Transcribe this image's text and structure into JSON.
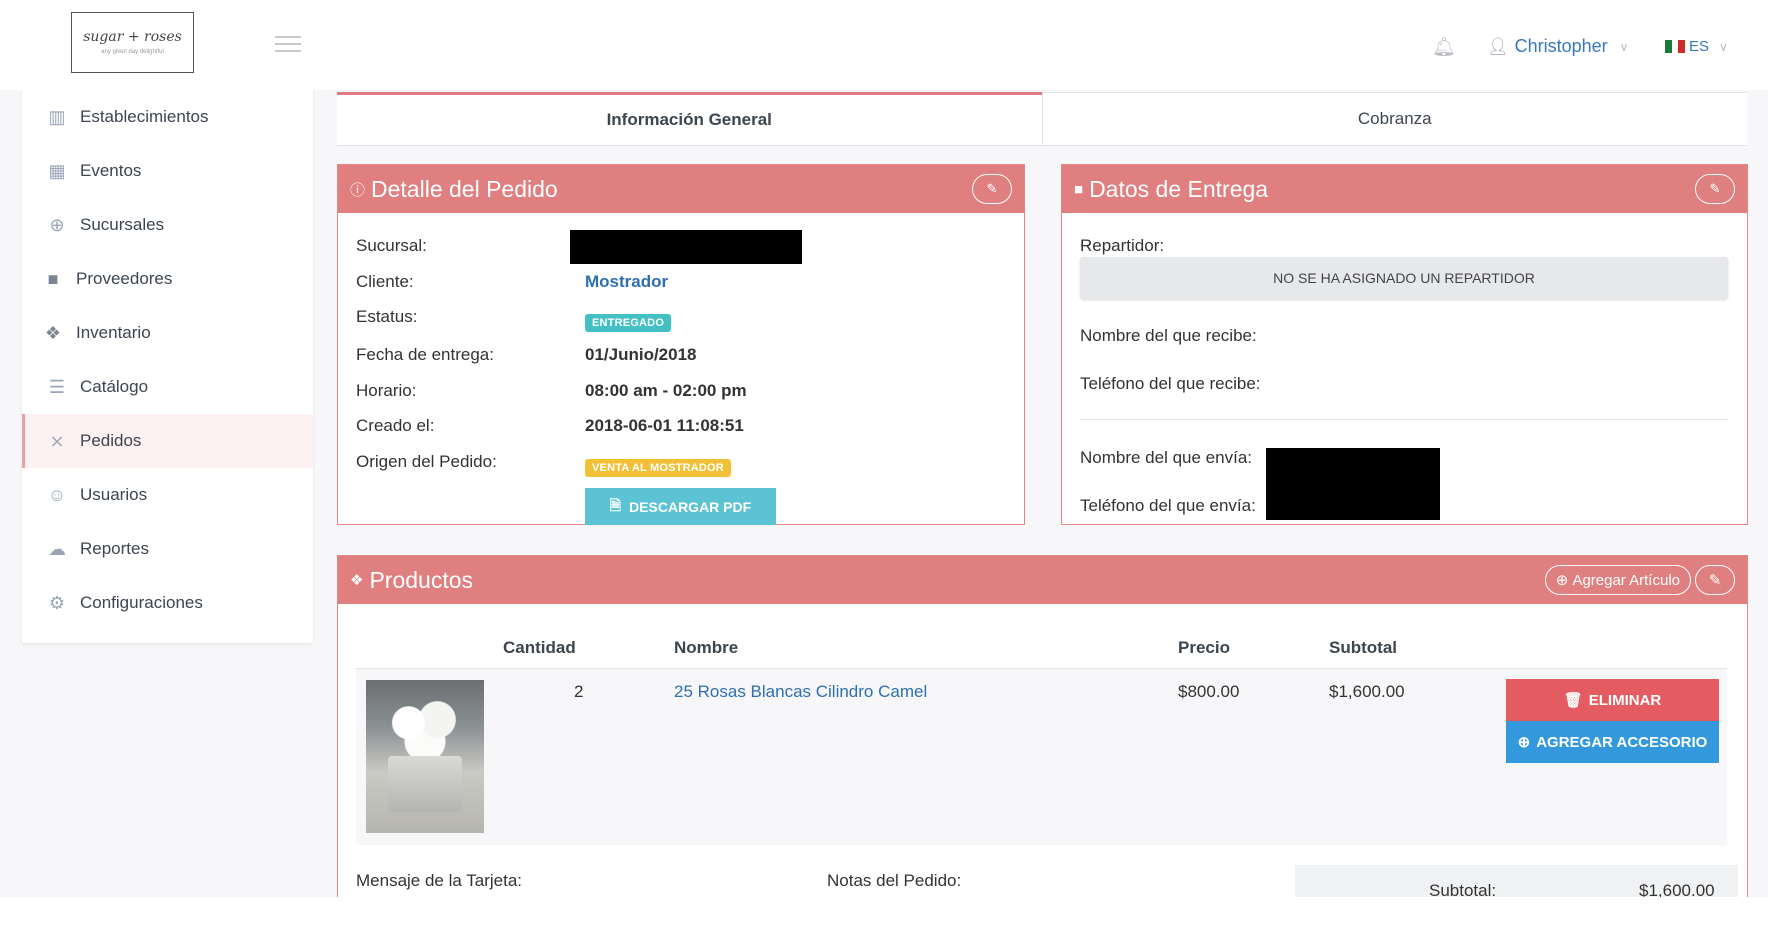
{
  "topbar": {
    "logo_text": "sugar + roses",
    "logo_tagline": "any given day delightful",
    "user_name": "Christopher",
    "language": "ES",
    "colors": {
      "user_link": "#3a78b9"
    }
  },
  "sidebar": {
    "items": [
      {
        "label": "Establecimientos",
        "icon": "map-icon"
      },
      {
        "label": "Eventos",
        "icon": "calendar-icon"
      },
      {
        "label": "Sucursales",
        "icon": "globe-icon"
      },
      {
        "label": "Proveedores",
        "icon": "truck-icon"
      },
      {
        "label": "Inventario",
        "icon": "cubes-icon"
      },
      {
        "label": "Catálogo",
        "icon": "list-icon"
      },
      {
        "label": "Pedidos",
        "icon": "cart-icon",
        "active": true
      },
      {
        "label": "Usuarios",
        "icon": "user-icon"
      },
      {
        "label": "Reportes",
        "icon": "cloud-icon"
      },
      {
        "label": "Configuraciones",
        "icon": "gear-icon"
      }
    ]
  },
  "tabs": [
    {
      "label": "Información General",
      "active": true
    },
    {
      "label": "Cobranza",
      "active": false
    }
  ],
  "order_detail": {
    "title": "Detalle del Pedido",
    "labels": {
      "branch": "Sucursal:",
      "client": "Cliente:",
      "status": "Estatus:",
      "delivery_date": "Fecha de entrega:",
      "schedule": "Horario:",
      "created": "Creado el:",
      "origin": "Origen del Pedido:"
    },
    "client": "Mostrador",
    "status": "ENTREGADO",
    "delivery_date": "01/Junio/2018",
    "schedule": "08:00 am - 02:00 pm",
    "created": "2018-06-01 11:08:51",
    "origin": "VENTA AL MOSTRADOR",
    "pdf_button": "DESCARGAR PDF"
  },
  "delivery": {
    "title": "Datos de Entrega",
    "courier_label": "Repartidor:",
    "no_courier": "NO SE HA ASIGNADO UN REPARTIDOR",
    "receiver_name_label": "Nombre del que recibe:",
    "receiver_phone_label": "Teléfono del que recibe:",
    "sender_name_label": "Nombre del que envía:",
    "sender_phone_label": "Teléfono del que envía:"
  },
  "products": {
    "title": "Productos",
    "add_button": "Agregar Artículo",
    "columns": [
      "Cantidad",
      "Nombre",
      "Precio",
      "Subtotal"
    ],
    "rows": [
      {
        "quantity": "2",
        "name": "25 Rosas Blancas Cilindro Camel",
        "price": "$800.00",
        "subtotal": "$1,600.00",
        "delete_label": "ELIMINAR",
        "accessory_label": "AGREGAR ACCESORIO"
      }
    ],
    "card_message_label": "Mensaje de la Tarjeta:",
    "notes_label": "Notas del Pedido:",
    "summary_subtotal_label": "Subtotal:",
    "summary_subtotal_value": "$1,600.00"
  },
  "theme": {
    "panel_header": "#e07f80",
    "delete": "#e45b61",
    "accessory": "#3399dc",
    "badge_status": "#42c0c4",
    "badge_origin": "#f2c037"
  }
}
